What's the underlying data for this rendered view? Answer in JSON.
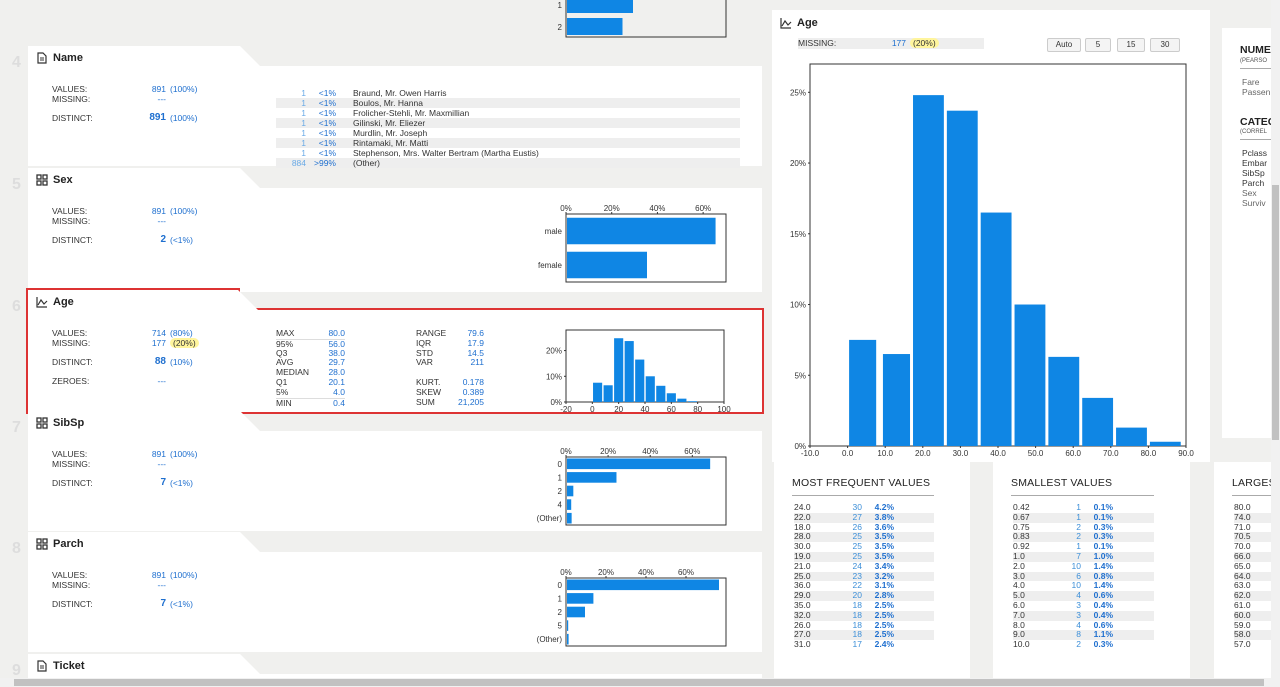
{
  "top_chart": {
    "categories": [
      "1",
      "2"
    ],
    "values": [
      0.44,
      0.37
    ]
  },
  "name_card": {
    "num": "4",
    "title": "Name",
    "values_label": "VALUES:",
    "values": "891",
    "values_pct": "(100%)",
    "missing_label": "MISSING:",
    "missing": "---",
    "distinct_label": "DISTINCT:",
    "distinct": "891",
    "distinct_pct": "(100%)",
    "freq": [
      {
        "count": "1",
        "pct": "<1%",
        "value": "Braund, Mr. Owen Harris"
      },
      {
        "count": "1",
        "pct": "<1%",
        "value": "Boulos, Mr. Hanna"
      },
      {
        "count": "1",
        "pct": "<1%",
        "value": "Frolicher-Stehli, Mr. Maxmillian"
      },
      {
        "count": "1",
        "pct": "<1%",
        "value": "Gilinski, Mr. Eliezer"
      },
      {
        "count": "1",
        "pct": "<1%",
        "value": "Murdlin, Mr. Joseph"
      },
      {
        "count": "1",
        "pct": "<1%",
        "value": "Rintamaki, Mr. Matti"
      },
      {
        "count": "1",
        "pct": "<1%",
        "value": "Stephenson, Mrs. Walter Bertram (Martha Eustis)"
      },
      {
        "count": "884",
        "pct": ">99%",
        "value": "(Other)"
      }
    ]
  },
  "sex_card": {
    "num": "5",
    "title": "Sex",
    "values_label": "VALUES:",
    "values": "891",
    "values_pct": "(100%)",
    "missing_label": "MISSING:",
    "missing": "---",
    "distinct_label": "DISTINCT:",
    "distinct": "2",
    "distinct_pct": "(<1%)"
  },
  "age_card": {
    "num": "6",
    "title": "Age",
    "values_label": "VALUES:",
    "values": "714",
    "values_pct": "(80%)",
    "missing_label": "MISSING:",
    "missing": "177",
    "missing_pct": "(20%)",
    "distinct_label": "DISTINCT:",
    "distinct": "88",
    "distinct_pct": "(10%)",
    "zeroes_label": "ZEROES:",
    "zeroes": "---",
    "quantiles": [
      {
        "k": "MAX",
        "v": "80.0"
      },
      {
        "k": "95%",
        "v": "56.0"
      },
      {
        "k": "Q3",
        "v": "38.0"
      },
      {
        "k": "AVG",
        "v": "29.7"
      },
      {
        "k": "MEDIAN",
        "v": "28.0"
      },
      {
        "k": "Q1",
        "v": "20.1"
      },
      {
        "k": "5%",
        "v": "4.0"
      },
      {
        "k": "MIN",
        "v": "0.4"
      }
    ],
    "desc": [
      {
        "k": "RANGE",
        "v": "79.6"
      },
      {
        "k": "IQR",
        "v": "17.9"
      },
      {
        "k": "STD",
        "v": "14.5"
      },
      {
        "k": "VAR",
        "v": "211"
      },
      {
        "k": "",
        "v": ""
      },
      {
        "k": "KURT.",
        "v": "0.178"
      },
      {
        "k": "SKEW",
        "v": "0.389"
      },
      {
        "k": "SUM",
        "v": "21,205"
      }
    ]
  },
  "sibsp_card": {
    "num": "7",
    "title": "SibSp",
    "values_label": "VALUES:",
    "values": "891",
    "values_pct": "(100%)",
    "missing_label": "MISSING:",
    "missing": "---",
    "distinct_label": "DISTINCT:",
    "distinct": "7",
    "distinct_pct": "(<1%)"
  },
  "parch_card": {
    "num": "8",
    "title": "Parch",
    "values_label": "VALUES:",
    "values": "891",
    "values_pct": "(100%)",
    "missing_label": "MISSING:",
    "missing": "---",
    "distinct_label": "DISTINCT:",
    "distinct": "7",
    "distinct_pct": "(<1%)"
  },
  "ticket_card": {
    "num": "9",
    "title": "Ticket"
  },
  "chart_data": [
    {
      "type": "bar",
      "id": "sex",
      "orientation": "horizontal",
      "categories": [
        "male",
        "female"
      ],
      "values": [
        65,
        35
      ],
      "xticks": [
        "0%",
        "20%",
        "40%",
        "60%"
      ],
      "xlim": [
        0,
        70
      ]
    },
    {
      "type": "bar",
      "id": "age_small",
      "categories": [
        "0",
        "5",
        "10",
        "15",
        "20",
        "25",
        "30",
        "35",
        "40",
        "45",
        "50",
        "55",
        "60",
        "65",
        "70",
        "75",
        "80"
      ],
      "values": [
        7.5,
        6.5,
        24.8,
        23.7,
        16.5,
        10.0,
        6.3,
        3.4,
        1.3,
        0.3
      ],
      "x": [
        0,
        10,
        20,
        30,
        40,
        50,
        60,
        70,
        80,
        90
      ],
      "xticks": [
        "-20",
        "0",
        "20",
        "40",
        "60",
        "80",
        "100"
      ],
      "yticks": [
        "0%",
        "10%",
        "20%"
      ],
      "xlim": [
        -20,
        100
      ],
      "ylim": [
        0,
        28
      ]
    },
    {
      "type": "bar",
      "id": "sibsp",
      "orientation": "horizontal",
      "categories": [
        "0",
        "1",
        "2",
        "4",
        "(Other)"
      ],
      "values": [
        68,
        23.5,
        3,
        2,
        2.2
      ],
      "xticks": [
        "0%",
        "20%",
        "40%",
        "60%"
      ],
      "xlim": [
        0,
        76
      ]
    },
    {
      "type": "bar",
      "id": "parch",
      "orientation": "horizontal",
      "categories": [
        "0",
        "1",
        "2",
        "5",
        "(Other)"
      ],
      "values": [
        76,
        13.2,
        9,
        0.6,
        0.8
      ],
      "xticks": [
        "0%",
        "20%",
        "40%",
        "60%"
      ],
      "xlim": [
        0,
        80
      ]
    },
    {
      "type": "bar",
      "id": "age_large",
      "title": "Age",
      "x": [
        0,
        10,
        20,
        30,
        40,
        50,
        60,
        70,
        80
      ],
      "values": [
        7.5,
        6.5,
        24.8,
        23.7,
        16.5,
        10.0,
        6.3,
        3.4,
        1.3,
        0.3
      ],
      "bins": [
        [
          0,
          8
        ],
        [
          9,
          17
        ],
        [
          17,
          26
        ],
        [
          26,
          35
        ],
        [
          35,
          44
        ],
        [
          44,
          53
        ],
        [
          53,
          62
        ],
        [
          62,
          71
        ],
        [
          71,
          80
        ],
        [
          80,
          89
        ]
      ],
      "xticks": [
        "-10.0",
        "0.0",
        "10.0",
        "20.0",
        "30.0",
        "40.0",
        "50.0",
        "60.0",
        "70.0",
        "80.0",
        "90.0"
      ],
      "yticks": [
        "0%",
        "5%",
        "10%",
        "15%",
        "20%",
        "25%"
      ],
      "xlim": [
        -10,
        90
      ],
      "ylim": [
        0,
        27
      ]
    }
  ],
  "panel": {
    "title": "Age",
    "missing_label": "MISSING:",
    "missing": "177",
    "missing_pct": "(20%)",
    "buttons": [
      "Auto",
      "5",
      "15",
      "30"
    ]
  },
  "most_frequent": {
    "title": "MOST FREQUENT VALUES",
    "rows": [
      [
        "24.0",
        "30",
        "4.2%"
      ],
      [
        "22.0",
        "27",
        "3.8%"
      ],
      [
        "18.0",
        "26",
        "3.6%"
      ],
      [
        "28.0",
        "25",
        "3.5%"
      ],
      [
        "30.0",
        "25",
        "3.5%"
      ],
      [
        "19.0",
        "25",
        "3.5%"
      ],
      [
        "21.0",
        "24",
        "3.4%"
      ],
      [
        "25.0",
        "23",
        "3.2%"
      ],
      [
        "36.0",
        "22",
        "3.1%"
      ],
      [
        "29.0",
        "20",
        "2.8%"
      ],
      [
        "35.0",
        "18",
        "2.5%"
      ],
      [
        "32.0",
        "18",
        "2.5%"
      ],
      [
        "26.0",
        "18",
        "2.5%"
      ],
      [
        "27.0",
        "18",
        "2.5%"
      ],
      [
        "31.0",
        "17",
        "2.4%"
      ]
    ]
  },
  "smallest": {
    "title": "SMALLEST VALUES",
    "rows": [
      [
        "0.42",
        "1",
        "0.1%"
      ],
      [
        "0.67",
        "1",
        "0.1%"
      ],
      [
        "0.75",
        "2",
        "0.3%"
      ],
      [
        "0.83",
        "2",
        "0.3%"
      ],
      [
        "0.92",
        "1",
        "0.1%"
      ],
      [
        "1.0",
        "7",
        "1.0%"
      ],
      [
        "2.0",
        "10",
        "1.4%"
      ],
      [
        "3.0",
        "6",
        "0.8%"
      ],
      [
        "4.0",
        "10",
        "1.4%"
      ],
      [
        "5.0",
        "4",
        "0.6%"
      ],
      [
        "6.0",
        "3",
        "0.4%"
      ],
      [
        "7.0",
        "3",
        "0.4%"
      ],
      [
        "8.0",
        "4",
        "0.6%"
      ],
      [
        "9.0",
        "8",
        "1.1%"
      ],
      [
        "10.0",
        "2",
        "0.3%"
      ]
    ]
  },
  "largest": {
    "title": "LARGES",
    "rows": [
      "80.0",
      "74.0",
      "71.0",
      "70.5",
      "70.0",
      "66.0",
      "65.0",
      "64.0",
      "63.0",
      "62.0",
      "61.0",
      "60.0",
      "59.0",
      "58.0",
      "57.0"
    ]
  },
  "right_panel": {
    "num_title": "NUME",
    "num_sub": "(PEARSO",
    "num_items": [
      "Fare",
      "Passen"
    ],
    "cat_title": "CATEG",
    "cat_sub": "(CORREL",
    "cat_items": [
      "Pclass",
      "Embar",
      "SibSp",
      "Parch",
      "Sex",
      "Surviv"
    ]
  },
  "colors": {
    "bar": "#0f86e4",
    "accent": "#1e6fcf",
    "selected": "#dd3333",
    "highlight": "#fff59d"
  }
}
